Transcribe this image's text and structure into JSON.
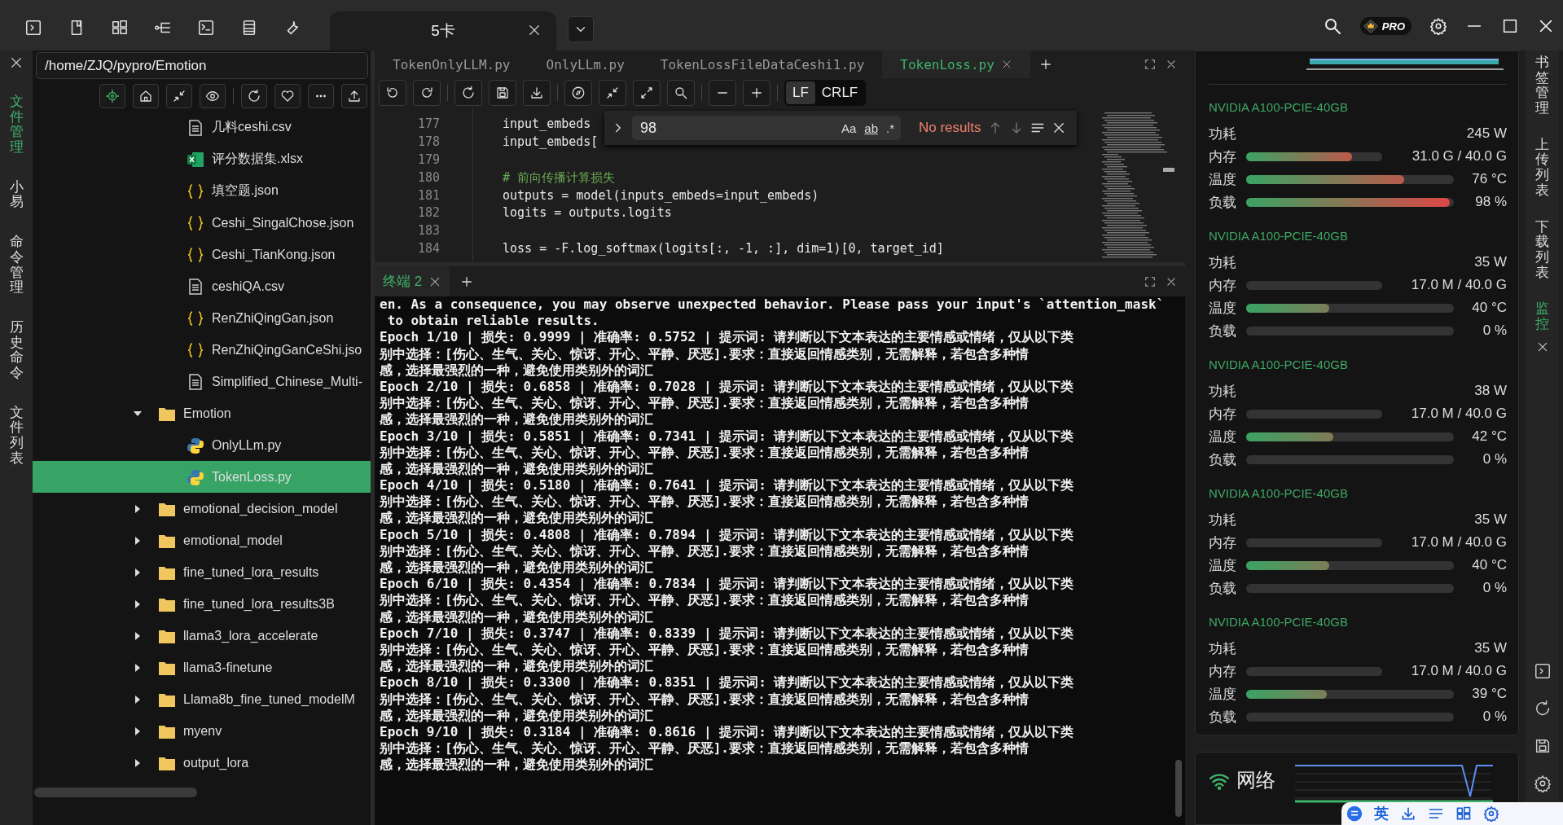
{
  "top_bar": {
    "session_tabs": [
      {
        "label": "5卡",
        "selected": true
      }
    ],
    "pro_badge": "PRO"
  },
  "left_rail": {
    "items": [
      {
        "label": "文件管理",
        "selected": true
      },
      {
        "label": "小易",
        "selected": false
      },
      {
        "label": "命令管理",
        "selected": false
      },
      {
        "label": "历史命令",
        "selected": false
      },
      {
        "label": "文件列表",
        "selected": false
      }
    ]
  },
  "file_panel": {
    "path": "/home/ZJQ/pypro/Emotion",
    "tree": [
      {
        "children": [
          {
            "name": "几料ceshi.csv",
            "kind": "text",
            "selected": false
          },
          {
            "name": "评分数据集.xlsx",
            "kind": "excel",
            "selected": false
          },
          {
            "name": "填空题.json",
            "kind": "json",
            "selected": false
          },
          {
            "name": "Ceshi_SingalChose.json",
            "kind": "json",
            "selected": false
          },
          {
            "name": "Ceshi_TianKong.json",
            "kind": "json",
            "selected": false
          },
          {
            "name": "ceshiQA.csv",
            "kind": "text",
            "selected": false
          },
          {
            "name": "RenZhiQingGan.json",
            "kind": "json",
            "selected": false
          },
          {
            "name": "RenZhiQingGanCeShi.jso",
            "kind": "json",
            "selected": false
          },
          {
            "name": "Simplified_Chinese_Multi-",
            "kind": "text",
            "selected": false
          }
        ]
      },
      {
        "name": "Emotion",
        "kind": "folder",
        "expanded": true,
        "selected": false,
        "children": [
          {
            "name": "OnlyLLm.py",
            "kind": "python",
            "selected": false
          },
          {
            "name": "TokenLoss.py",
            "kind": "python",
            "selected": true
          }
        ]
      },
      {
        "name": "emotional_decision_model",
        "kind": "folder",
        "expanded": false,
        "selected": false
      },
      {
        "name": "emotional_model",
        "kind": "folder",
        "expanded": false,
        "selected": false
      },
      {
        "name": "fine_tuned_lora_results",
        "kind": "folder",
        "expanded": false,
        "selected": false
      },
      {
        "name": "fine_tuned_lora_results3B",
        "kind": "folder",
        "expanded": false,
        "selected": false
      },
      {
        "name": "llama3_lora_accelerate",
        "kind": "folder",
        "expanded": false,
        "selected": false
      },
      {
        "name": "llama3-finetune",
        "kind": "folder",
        "expanded": false,
        "selected": false
      },
      {
        "name": "Llama8b_fine_tuned_modelM",
        "kind": "folder",
        "expanded": false,
        "selected": false
      },
      {
        "name": "myenv",
        "kind": "folder",
        "expanded": false,
        "selected": false
      },
      {
        "name": "output_lora",
        "kind": "folder",
        "expanded": false,
        "selected": false
      }
    ]
  },
  "editor": {
    "tabs": [
      {
        "label": "TokenOnlyLLM.py",
        "selected": false
      },
      {
        "label": "OnlyLLm.py",
        "selected": false
      },
      {
        "label": "TokenLossFileDataCeshi1.py",
        "selected": false
      },
      {
        "label": "TokenLoss.py",
        "selected": true
      }
    ],
    "line_endings": [
      {
        "label": "LF",
        "selected": true
      },
      {
        "label": "CRLF",
        "selected": false
      }
    ],
    "find": {
      "value": "98",
      "case_label": "Aa",
      "word_label": "ab",
      "regex_label": ".*",
      "status": "No results"
    },
    "lines": [
      {
        "number": "177",
        "text": "input_embeds",
        "kind": "code"
      },
      {
        "number": "178",
        "text": "input_embeds[",
        "kind": "code"
      },
      {
        "number": "179",
        "kind": "code"
      },
      {
        "number": "180",
        "text": "# 前向传播计算损失",
        "kind": "comment"
      },
      {
        "number": "181",
        "text": "outputs = model(inputs_embeds=input_embeds)",
        "kind": "code"
      },
      {
        "number": "182",
        "text": "logits = outputs.logits",
        "kind": "code"
      },
      {
        "number": "183",
        "kind": "code"
      },
      {
        "number": "184",
        "text": "loss = -F.log_softmax(logits[:, -1, :], dim=1)[0, target_id]",
        "kind": "code"
      }
    ]
  },
  "terminal": {
    "tabs": [
      {
        "label": "终端 2",
        "selected": true
      }
    ],
    "lines": [
      "en. As a consequence, you may observe unexpected behavior. Please pass your input's `attention_mask`",
      " to obtain reliable results.",
      "Epoch 1/10 | 损失: 0.9999 | 准确率: 0.5752 | 提示词: 请判断以下文本表达的主要情感或情绪，仅从以下类",
      "别中选择：[伤心、生气、关心、惊讶、开心、平静、厌恶].要求：直接返回情感类别，无需解释，若包含多种情",
      "感，选择最强烈的一种，避免使用类别外的词汇",
      "Epoch 2/10 | 损失: 0.6858 | 准确率: 0.7028 | 提示词: 请判断以下文本表达的主要情感或情绪，仅从以下类",
      "别中选择：[伤心、生气、关心、惊讶、开心、平静、厌恶].要求：直接返回情感类别，无需解释，若包含多种情",
      "感，选择最强烈的一种，避免使用类别外的词汇",
      "Epoch 3/10 | 损失: 0.5851 | 准确率: 0.7341 | 提示词: 请判断以下文本表达的主要情感或情绪，仅从以下类",
      "别中选择：[伤心、生气、关心、惊讶、开心、平静、厌恶].要求：直接返回情感类别，无需解释，若包含多种情",
      "感，选择最强烈的一种，避免使用类别外的词汇",
      "Epoch 4/10 | 损失: 0.5180 | 准确率: 0.7641 | 提示词: 请判断以下文本表达的主要情感或情绪，仅从以下类",
      "别中选择：[伤心、生气、关心、惊讶、开心、平静、厌恶].要求：直接返回情感类别，无需解释，若包含多种情",
      "感，选择最强烈的一种，避免使用类别外的词汇",
      "Epoch 5/10 | 损失: 0.4808 | 准确率: 0.7894 | 提示词: 请判断以下文本表达的主要情感或情绪，仅从以下类",
      "别中选择：[伤心、生气、关心、惊讶、开心、平静、厌恶].要求：直接返回情感类别，无需解释，若包含多种情",
      "感，选择最强烈的一种，避免使用类别外的词汇",
      "Epoch 6/10 | 损失: 0.4354 | 准确率: 0.7834 | 提示词: 请判断以下文本表达的主要情感或情绪，仅从以下类",
      "别中选择：[伤心、生气、关心、惊讶、开心、平静、厌恶].要求：直接返回情感类别，无需解释，若包含多种情",
      "感，选择最强烈的一种，避免使用类别外的词汇",
      "Epoch 7/10 | 损失: 0.3747 | 准确率: 0.8339 | 提示词: 请判断以下文本表达的主要情感或情绪，仅从以下类",
      "别中选择：[伤心、生气、关心、惊讶、开心、平静、厌恶].要求：直接返回情感类别，无需解释，若包含多种情",
      "感，选择最强烈的一种，避免使用类别外的词汇",
      "Epoch 8/10 | 损失: 0.3300 | 准确率: 0.8351 | 提示词: 请判断以下文本表达的主要情感或情绪，仅从以下类",
      "别中选择：[伤心、生气、关心、惊讶、开心、平静、厌恶].要求：直接返回情感类别，无需解释，若包含多种情",
      "感，选择最强烈的一种，避免使用类别外的词汇",
      "Epoch 9/10 | 损失: 0.3184 | 准确率: 0.8616 | 提示词: 请判断以下文本表达的主要情感或情绪，仅从以下类",
      "别中选择：[伤心、生气、关心、惊讶、开心、平静、厌恶].要求：直接返回情感类别，无需解释，若包含多种情",
      "感，选择最强烈的一种，避免使用类别外的词汇"
    ]
  },
  "monitor": {
    "gpus": [
      {
        "name": "NVIDIA A100-PCIE-40GB",
        "rows": [
          {
            "kind": "value",
            "label": "功耗",
            "reading": "245 W"
          },
          {
            "kind": "short_bar",
            "label": "内存",
            "level": 0.78,
            "reading": "31.0 G / 40.0 G"
          },
          {
            "kind": "bar",
            "label": "温度",
            "level": 0.76,
            "reading": "76 °C"
          },
          {
            "kind": "bar",
            "label": "负载",
            "level": 0.98,
            "reading": "98 %"
          }
        ]
      },
      {
        "name": "NVIDIA A100-PCIE-40GB",
        "rows": [
          {
            "kind": "value",
            "label": "功耗",
            "reading": "35 W"
          },
          {
            "kind": "short_bar",
            "label": "内存",
            "level": 0,
            "reading": "17.0 M / 40.0 G"
          },
          {
            "kind": "bar",
            "label": "温度",
            "level": 0.4,
            "reading": "40 °C"
          },
          {
            "kind": "bar",
            "label": "负载",
            "level": 0,
            "reading": "0 %"
          }
        ]
      },
      {
        "name": "NVIDIA A100-PCIE-40GB",
        "rows": [
          {
            "kind": "value",
            "label": "功耗",
            "reading": "38 W"
          },
          {
            "kind": "short_bar",
            "label": "内存",
            "level": 0,
            "reading": "17.0 M / 40.0 G"
          },
          {
            "kind": "bar",
            "label": "温度",
            "level": 0.42,
            "reading": "42 °C"
          },
          {
            "kind": "bar",
            "label": "负载",
            "level": 0,
            "reading": "0 %"
          }
        ]
      },
      {
        "name": "NVIDIA A100-PCIE-40GB",
        "rows": [
          {
            "kind": "value",
            "label": "功耗",
            "reading": "35 W"
          },
          {
            "kind": "short_bar",
            "label": "内存",
            "level": 0,
            "reading": "17.0 M / 40.0 G"
          },
          {
            "kind": "bar",
            "label": "温度",
            "level": 0.4,
            "reading": "40 °C"
          },
          {
            "kind": "bar",
            "label": "负载",
            "level": 0,
            "reading": "0 %"
          }
        ]
      },
      {
        "name": "NVIDIA A100-PCIE-40GB",
        "rows": [
          {
            "kind": "value",
            "label": "功耗",
            "reading": "35 W"
          },
          {
            "kind": "short_bar",
            "label": "内存",
            "level": 0,
            "reading": "17.0 M / 40.0 G"
          },
          {
            "kind": "bar",
            "label": "温度",
            "level": 0.39,
            "reading": "39 °C"
          },
          {
            "kind": "bar",
            "label": "负载",
            "level": 0,
            "reading": "0 %"
          }
        ]
      }
    ],
    "network": {
      "label": "网络"
    }
  },
  "right_rail": {
    "items": [
      {
        "label": "书签管理",
        "selected": false
      },
      {
        "label": "上传列表",
        "selected": false
      },
      {
        "label": "下载列表",
        "selected": false
      },
      {
        "label": "监控",
        "selected": true
      }
    ]
  },
  "ime_bar": {
    "label": "英"
  }
}
